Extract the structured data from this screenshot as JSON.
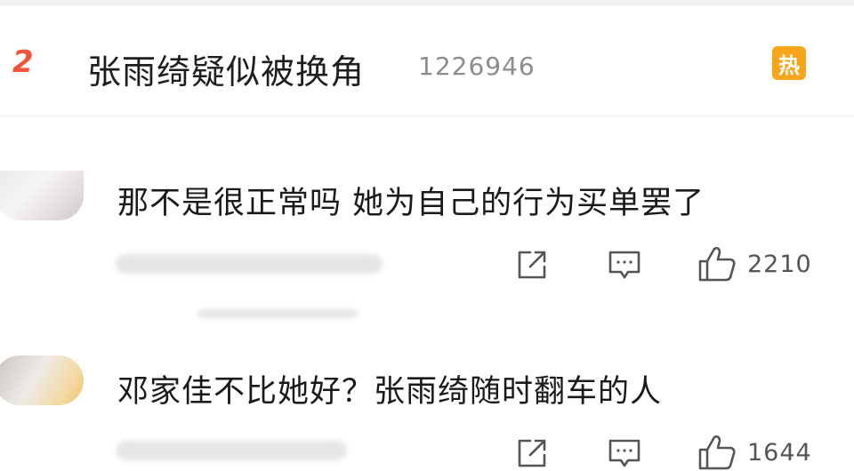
{
  "hot_topic": {
    "rank": "2",
    "title": "张雨绮疑似被换角",
    "count": "1226946",
    "badge": "热",
    "badge_color": "#f7a51b",
    "rank_color": "#f0533a"
  },
  "comments": [
    {
      "text": "那不是很正常吗 她为自己的行为买单罢了",
      "likes": "2210",
      "share_icon": "share-icon",
      "reply_icon": "comment-icon",
      "like_icon": "thumbs-up-icon"
    },
    {
      "text": "邓家佳不比她好？张雨绮随时翻车的人",
      "likes": "1644",
      "share_icon": "share-icon",
      "reply_icon": "comment-icon",
      "like_icon": "thumbs-up-icon"
    }
  ]
}
